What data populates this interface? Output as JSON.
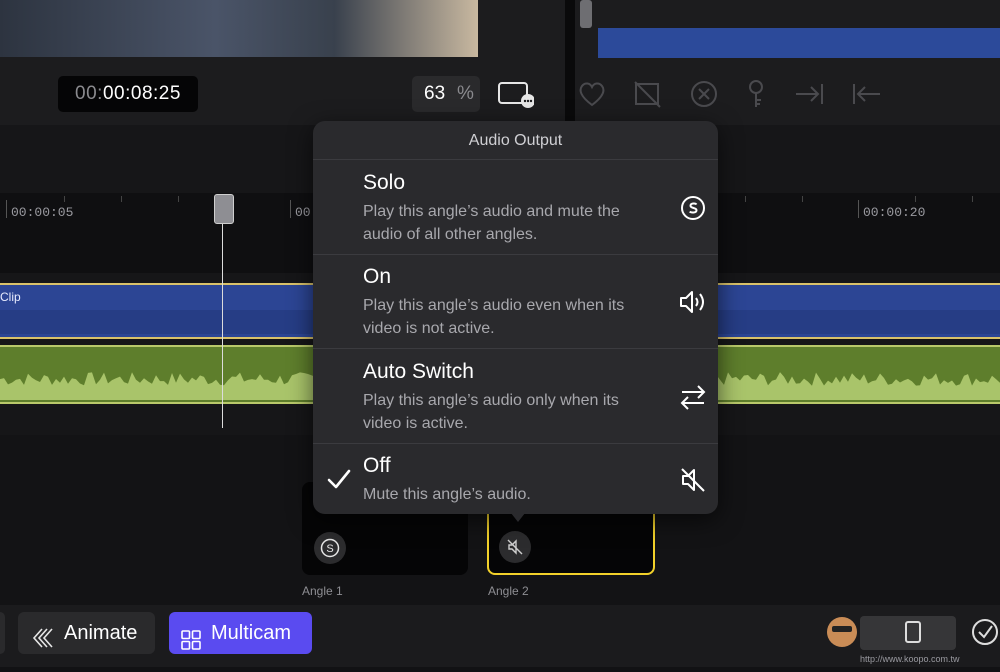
{
  "viewer": {
    "timecode_prefix": "00:",
    "timecode_main": "00:08:25",
    "zoom_value": "63",
    "zoom_unit": "%"
  },
  "timeline": {
    "ruler_labels": [
      "00:00:05",
      "00:",
      "00:00:20"
    ],
    "clip_label": "Clip"
  },
  "popover": {
    "title": "Audio Output",
    "options": [
      {
        "title": "Solo",
        "desc_line1": "Play this angle’s audio and mute the",
        "desc_line2": "audio of all other angles.",
        "icon": "solo-icon"
      },
      {
        "title": "On",
        "desc_line1": "Play this angle’s audio even when its",
        "desc_line2": "video is not active.",
        "icon": "speaker-icon"
      },
      {
        "title": "Auto Switch",
        "desc_line1": "Play this angle’s audio only when its",
        "desc_line2": "video is active.",
        "icon": "switch-arrows-icon"
      },
      {
        "title": "Off",
        "desc_line1": "Mute this angle’s audio.",
        "desc_line2": "",
        "icon": "speaker-muted-icon",
        "selected": true
      }
    ]
  },
  "angles": [
    {
      "label": "Angle 1",
      "badge": "S"
    },
    {
      "label": "Angle 2",
      "badge": "muted",
      "active": true
    }
  ],
  "toolbar": {
    "animate_label": "Animate",
    "multicam_label": "Multicam"
  },
  "watermark": {
    "site": "http://www.koopo.com.tw"
  },
  "colors": {
    "accent": "#5a4bf0",
    "active_angle_border": "#f2d12a",
    "video_clip": "#2c4594",
    "audio_clip": "#5e7e2c"
  }
}
